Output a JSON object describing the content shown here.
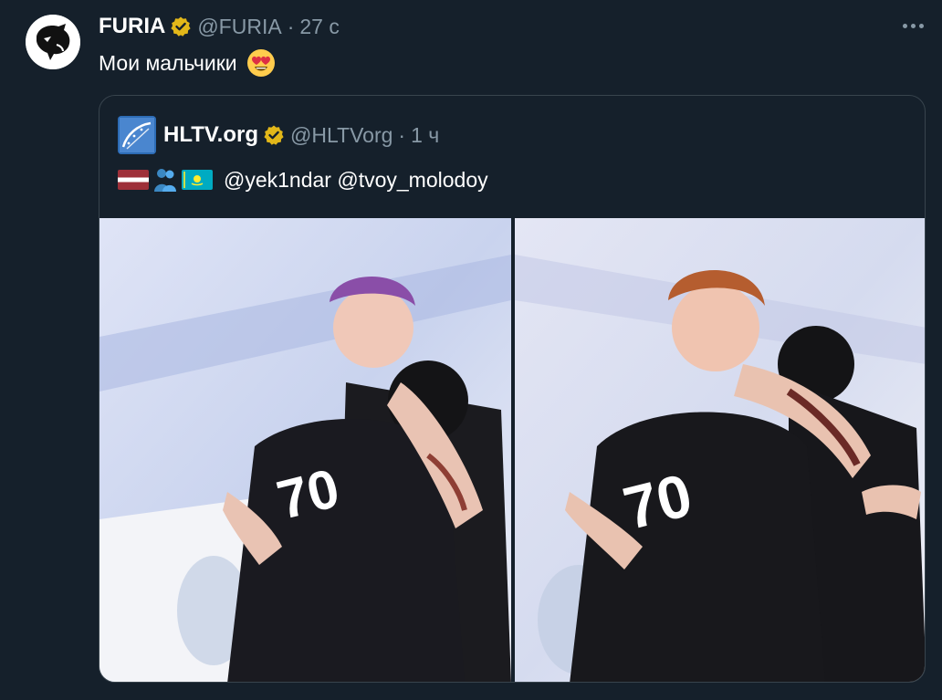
{
  "tweet": {
    "author_name": "FURIA",
    "author_handle": "@FURIA",
    "separator": "·",
    "time": "27 с",
    "text": "Мои мальчики",
    "avatar_icon": "panther-logo-icon",
    "emoji": "heart-eyes-emoji"
  },
  "quoted": {
    "author_name": "HLTV.org",
    "author_handle": "@HLTVorg",
    "separator": "·",
    "time": "1 ч",
    "avatar_icon": "hltv-logo-icon",
    "flags": [
      "latvia-flag",
      "people-hugging-emoji",
      "kazakhstan-flag"
    ],
    "mention_1": "@yek1ndar",
    "mention_2": "@tvoy_molodoy",
    "photos": [
      "players-hugging-photo-left",
      "players-hugging-photo-right"
    ]
  },
  "colors": {
    "background": "#15202b",
    "muted_text": "#8899a6",
    "border": "#38444d",
    "verified_gold": "#e2b719"
  }
}
